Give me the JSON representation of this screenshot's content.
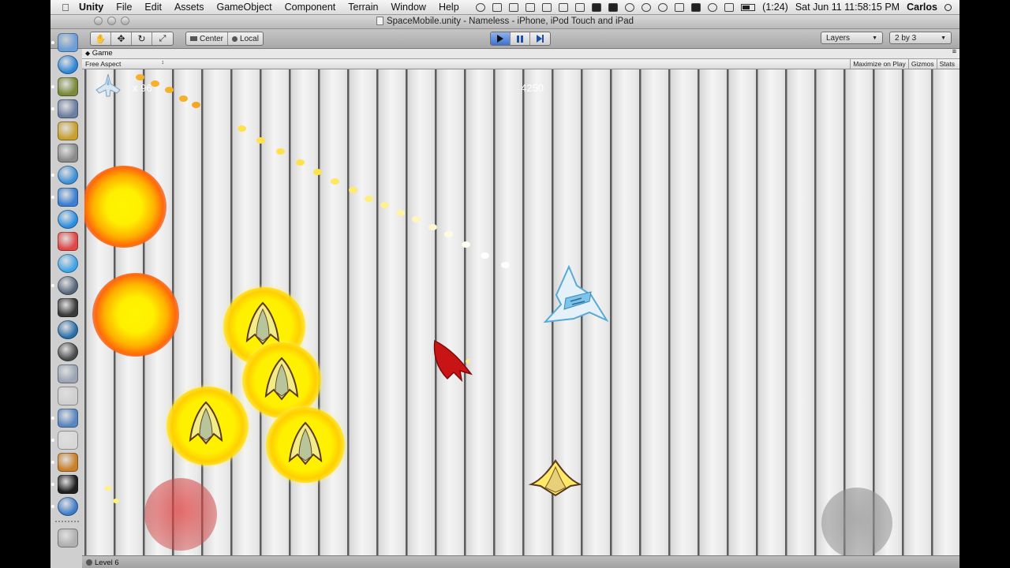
{
  "menubar": {
    "app_name": "Unity",
    "items": [
      "File",
      "Edit",
      "Assets",
      "GameObject",
      "Component",
      "Terrain",
      "Window",
      "Help"
    ],
    "battery": "(1:24)",
    "clock": "Sat Jun 11  11:58:15 PM",
    "user": "Carlos"
  },
  "window": {
    "title": "SpaceMobile.unity - Nameless - iPhone, iPod Touch and iPad"
  },
  "toolbar": {
    "pivot_label": "Center",
    "space_label": "Local",
    "layers_label": "Layers",
    "layout_label": "2 by 3"
  },
  "game_view": {
    "tab_label": "Game",
    "aspect_label": "Free Aspect",
    "maximize_label": "Maximize on Play",
    "gizmos_label": "Gizmos",
    "stats_label": "Stats"
  },
  "hud": {
    "lives": "x 96",
    "score": "4250"
  },
  "status": {
    "level": "Level 6"
  },
  "dock_items": [
    {
      "name": "finder-icon",
      "color": "#6d9ed8"
    },
    {
      "name": "app-store-icon",
      "color": "#2f86d6"
    },
    {
      "name": "game-app-icon",
      "color": "#7a8a3a"
    },
    {
      "name": "preview-icon",
      "color": "#6c7fa0"
    },
    {
      "name": "texture-tool-icon",
      "color": "#c9a030"
    },
    {
      "name": "database-icon",
      "color": "#8a8a8a"
    },
    {
      "name": "safari-icon",
      "color": "#3d8fd6"
    },
    {
      "name": "mail-icon",
      "color": "#3b7fd2"
    },
    {
      "name": "itunes-icon",
      "color": "#2a8ee0"
    },
    {
      "name": "calendar-icon",
      "color": "#e04848"
    },
    {
      "name": "ichat-icon",
      "color": "#3fa4e8"
    },
    {
      "name": "pen-tool-icon",
      "color": "#55667a"
    },
    {
      "name": "eve-icon",
      "color": "#3a3a3a"
    },
    {
      "name": "portal-icon",
      "color": "#2a6ea8"
    },
    {
      "name": "steam-icon",
      "color": "#4a4a4a"
    },
    {
      "name": "utility-icon",
      "color": "#9aa4b4"
    },
    {
      "name": "joystick-icon",
      "color": "#cfcfcf"
    },
    {
      "name": "xcode-icon",
      "color": "#5a86c0"
    },
    {
      "name": "textedit-icon",
      "color": "#d7d7d7"
    },
    {
      "name": "image-capture-icon",
      "color": "#c9802a"
    },
    {
      "name": "unity-icon",
      "color": "#202020"
    },
    {
      "name": "silverlock-icon",
      "color": "#3e7cc8"
    },
    {
      "name": "trash-icon",
      "color": "#b0b0b0"
    }
  ],
  "colors": {
    "play_active": "#3f72d0",
    "explosion_core": "#fff200",
    "enemy_red": "#c81414"
  }
}
